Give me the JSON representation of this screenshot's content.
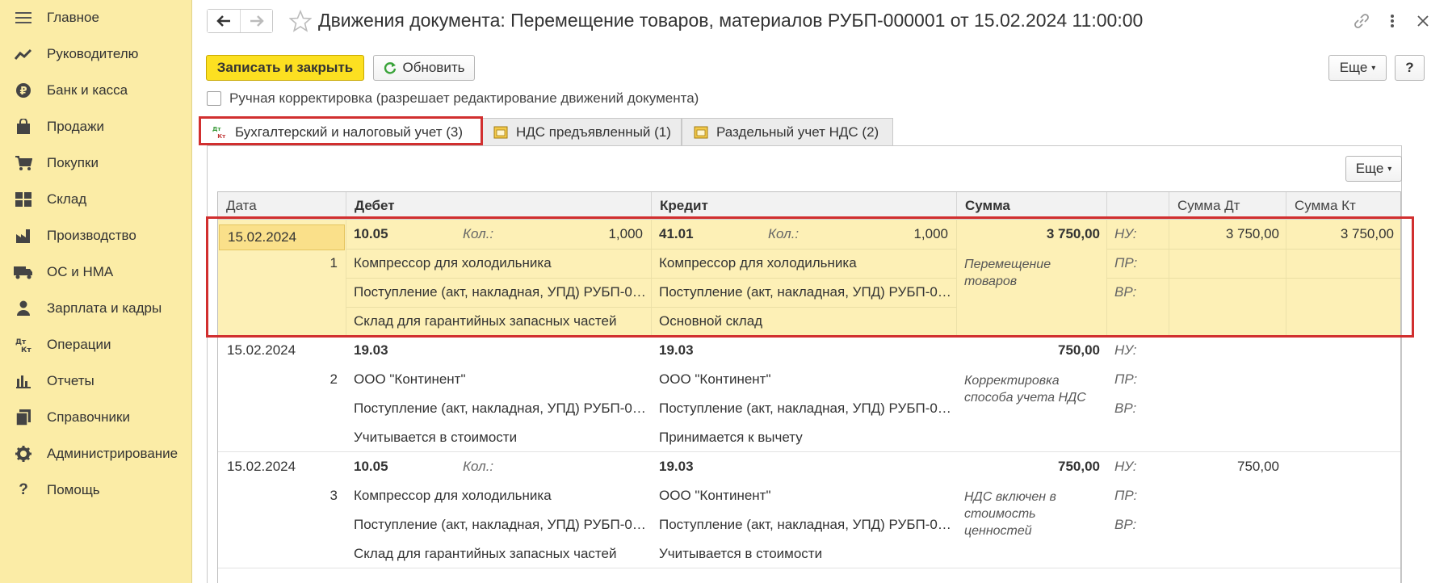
{
  "sidebar": {
    "items": [
      {
        "label": "Главное",
        "icon": "menu-icon"
      },
      {
        "label": "Руководителю",
        "icon": "trend-icon"
      },
      {
        "label": "Банк и касса",
        "icon": "ruble-icon"
      },
      {
        "label": "Продажи",
        "icon": "bag-icon"
      },
      {
        "label": "Покупки",
        "icon": "cart-icon"
      },
      {
        "label": "Склад",
        "icon": "warehouse-icon"
      },
      {
        "label": "Производство",
        "icon": "factory-icon"
      },
      {
        "label": "ОС и НМА",
        "icon": "truck-icon"
      },
      {
        "label": "Зарплата и кадры",
        "icon": "person-icon"
      },
      {
        "label": "Операции",
        "icon": "dt-kt-icon"
      },
      {
        "label": "Отчеты",
        "icon": "bar-chart-icon"
      },
      {
        "label": "Справочники",
        "icon": "books-icon"
      },
      {
        "label": "Администрирование",
        "icon": "gear-icon"
      },
      {
        "label": "Помощь",
        "icon": "question-icon"
      }
    ]
  },
  "header": {
    "title": "Движения документа: Перемещение товаров, материалов РУБП-000001 от 15.02.2024 11:00:00"
  },
  "toolbar": {
    "save_close_label": "Записать и закрыть",
    "refresh_label": "Обновить",
    "more_label": "Еще",
    "help_label": "?",
    "manual_label": "Ручная корректировка (разрешает редактирование движений документа)"
  },
  "tabs": [
    {
      "label": "Бухгалтерский и налоговый учет (3)",
      "active": true
    },
    {
      "label": "НДС предъявленный (1)",
      "active": false
    },
    {
      "label": "Раздельный учет НДС (2)",
      "active": false
    }
  ],
  "table": {
    "more_label": "Еще",
    "columns": [
      "Дата",
      "Дебет",
      "Кредит",
      "Сумма",
      "",
      "Сумма Дт",
      "Сумма Кт"
    ],
    "qty_label": "Кол.:",
    "nu": "НУ:",
    "pr": "ПР:",
    "vr": "ВР:",
    "rows": [
      {
        "date": "15.02.2024",
        "num": "1",
        "debit_account": "10.05",
        "debit_qty": "1,000",
        "debit_sub1": "Компрессор для холодильника",
        "debit_sub2": "Поступление (акт, накладная, УПД) РУБП-0…",
        "debit_sub3": "Склад для гарантийных запасных частей",
        "credit_account": "41.01",
        "credit_qty": "1,000",
        "credit_sub1": "Компрессор для холодильника",
        "credit_sub2": "Поступление (акт, накладная, УПД) РУБП-0…",
        "credit_sub3": "Основной склад",
        "amount": "3 750,00",
        "content": "Перемещение товаров",
        "sum_dt": "3 750,00",
        "sum_kt": "3 750,00"
      },
      {
        "date": "15.02.2024",
        "num": "2",
        "debit_account": "19.03",
        "debit_sub1": "ООО \"Континент\"",
        "debit_sub2": "Поступление (акт, накладная, УПД) РУБП-0…",
        "debit_sub3": "Учитывается в стоимости",
        "credit_account": "19.03",
        "credit_sub1": "ООО \"Континент\"",
        "credit_sub2": "Поступление (акт, накладная, УПД) РУБП-0…",
        "credit_sub3": "Принимается к вычету",
        "amount": "750,00",
        "content": "Корректировка способа учета НДС",
        "sum_dt": "",
        "sum_kt": ""
      },
      {
        "date": "15.02.2024",
        "num": "3",
        "debit_account": "10.05",
        "debit_qty_label": "Кол.:",
        "debit_sub1": "Компрессор для холодильника",
        "debit_sub2": "Поступление (акт, накладная, УПД) РУБП-0…",
        "debit_sub3": "Склад для гарантийных запасных частей",
        "credit_account": "19.03",
        "credit_sub1": "ООО \"Континент\"",
        "credit_sub2": "Поступление (акт, накладная, УПД) РУБП-0…",
        "credit_sub3": "Учитывается в стоимости",
        "amount": "750,00",
        "content": "НДС включен в стоимость ценностей",
        "sum_dt": "750,00",
        "sum_kt": ""
      }
    ]
  }
}
